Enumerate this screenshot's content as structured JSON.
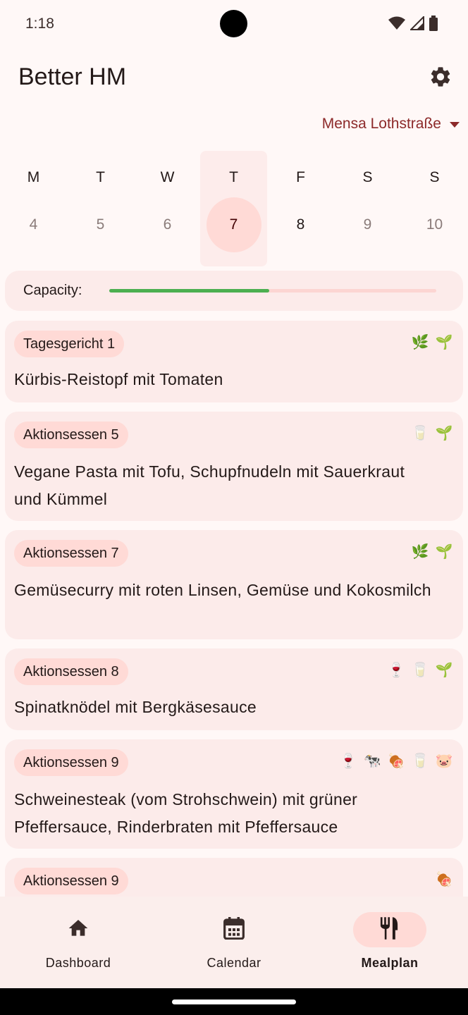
{
  "status_bar": {
    "time": "1:18"
  },
  "app_bar": {
    "title": "Better HM"
  },
  "mensa": {
    "selected": "Mensa Lothstraße"
  },
  "week": {
    "days": [
      {
        "letter": "M",
        "num": "4"
      },
      {
        "letter": "T",
        "num": "5"
      },
      {
        "letter": "W",
        "num": "6"
      },
      {
        "letter": "T",
        "num": "7"
      },
      {
        "letter": "F",
        "num": "8"
      },
      {
        "letter": "S",
        "num": "9"
      },
      {
        "letter": "S",
        "num": "10"
      }
    ]
  },
  "capacity": {
    "label": "Capacity:",
    "level": 0.49
  },
  "meals": [
    {
      "category": "Tagesgericht 1",
      "name": "Kürbis-Reistopf mit Tomaten",
      "icons": [
        "herb-icon",
        "seedling-icon"
      ]
    },
    {
      "category": "Aktionsessen 5",
      "name": "Vegane Pasta mit Tofu, Schupfnudeln mit Sauerkraut und Kümmel",
      "icons": [
        "milk-icon",
        "seedling-icon"
      ]
    },
    {
      "category": "Aktionsessen 7",
      "name": "Gemüsecurry mit roten Linsen, Gemüse und Kokosmilch",
      "icons": [
        "herb-icon",
        "seedling-icon"
      ]
    },
    {
      "category": "Aktionsessen 8",
      "name": "Spinatknödel mit Bergkäsesauce",
      "icons": [
        "wine-icon",
        "milk-icon",
        "seedling-icon"
      ]
    },
    {
      "category": "Aktionsessen 9",
      "name": "Schweinesteak (vom Strohschwein) mit grüner Pfeffersauce, Rinderbraten mit Pfeffersauce",
      "icons": [
        "wine-icon",
        "cow-icon",
        "meat-icon",
        "milk-icon",
        "pig-icon"
      ]
    },
    {
      "category": "Aktionsessen 9",
      "name": "",
      "icons": [
        "meat-icon"
      ]
    }
  ],
  "nav": {
    "items": [
      {
        "label": "Dashboard",
        "icon": "home-icon"
      },
      {
        "label": "Calendar",
        "icon": "calendar-icon"
      },
      {
        "label": "Mealplan",
        "icon": "utensils-icon"
      }
    ]
  },
  "colors": {
    "accent": "#8c2a2a",
    "capacity_fill": "#4caf50",
    "card_bg": "#fcebea",
    "badge_bg": "#ffdad6"
  }
}
